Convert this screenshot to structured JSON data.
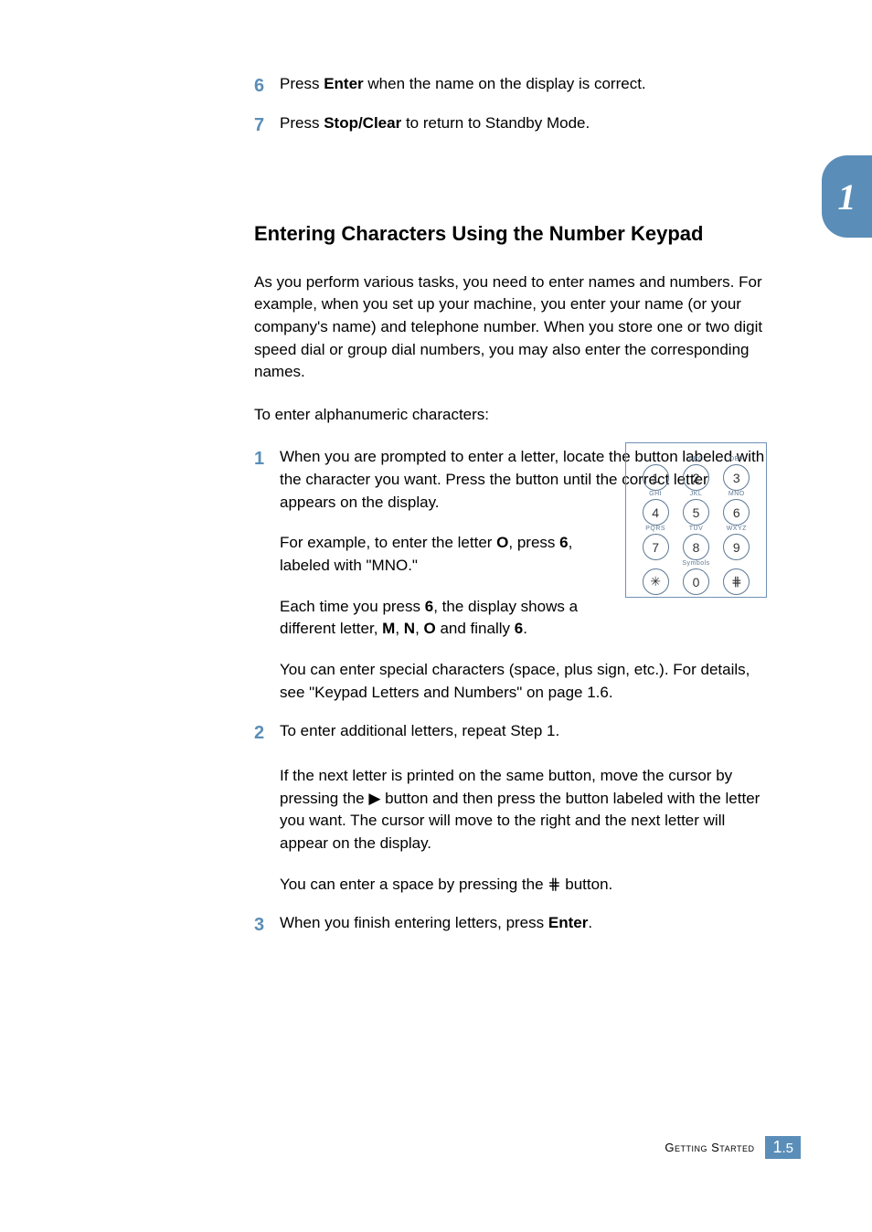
{
  "tab": "1",
  "cont_steps": [
    {
      "num": "6",
      "html": "Press <b>Enter</b> when the name on the display is correct."
    },
    {
      "num": "7",
      "html": "Press <b>Stop/Clear</b> to return to Standby Mode."
    }
  ],
  "heading": "Entering Characters Using the Number Keypad",
  "paras": [
    "As you perform various tasks, you need to enter names and numbers. For example, when you set up your machine, you enter your name (or your company's name) and telephone number. When you store one or two digit speed dial or group dial numbers, you may also enter the corresponding names.",
    "To enter alphanumeric characters:"
  ],
  "steps": [
    {
      "num": "1",
      "blocks": [
        "When you are prompted to enter a letter, locate the button labeled with the character you want. Press the button until the correct letter appears on the display.",
        "For example, to enter the letter <b>O</b>, press <b>6</b>, labeled with \"MNO.\"",
        "Each time you press <b>6</b>, the display shows a different letter, <b>M</b>, <b>N</b>, <b>O</b> and finally <b>6</b>.",
        "You can enter special characters (space, plus sign, etc.). For details, see \"Keypad Letters and Numbers\" on page 1.6."
      ]
    },
    {
      "num": "2",
      "blocks": [
        "To enter additional letters, repeat Step 1.",
        "If the next letter is printed on the same button, move the cursor by pressing the ▶ button and then press the button labeled with the letter you want. The cursor will move to the right and the next letter will appear on the display.",
        "You can enter a space by pressing the ⋕ button."
      ]
    },
    {
      "num": "3",
      "blocks": [
        "When you finish entering letters, press <b>Enter</b>."
      ]
    }
  ],
  "keypad": [
    [
      {
        "l": "",
        "b": "1"
      },
      {
        "l": "ABC",
        "b": "2"
      },
      {
        "l": "DEF",
        "b": "3"
      }
    ],
    [
      {
        "l": "GHI",
        "b": "4"
      },
      {
        "l": "JKL",
        "b": "5"
      },
      {
        "l": "MNO",
        "b": "6"
      }
    ],
    [
      {
        "l": "PQRS",
        "b": "7"
      },
      {
        "l": "TUV",
        "b": "8"
      },
      {
        "l": "WXYZ",
        "b": "9"
      }
    ],
    [
      {
        "l": "",
        "b": "✳"
      },
      {
        "l": "Symbols",
        "b": "0"
      },
      {
        "l": "",
        "b": "⋕"
      }
    ]
  ],
  "footer": {
    "label": "Getting Started",
    "chapter": "1",
    "page": ".5"
  }
}
